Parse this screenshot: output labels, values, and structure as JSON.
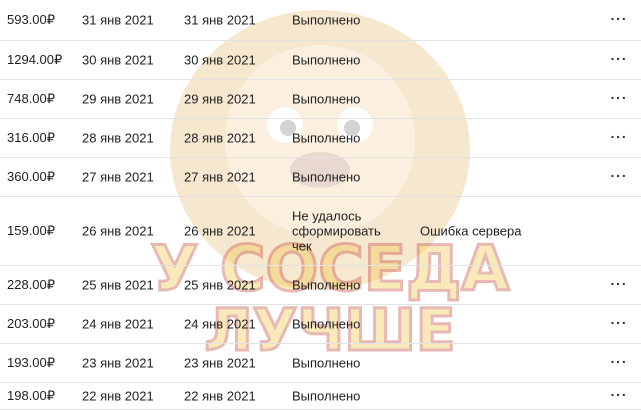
{
  "menu_glyph": "···",
  "rows": [
    {
      "amount": "593.00₽",
      "date_created": "31 янв 2021",
      "date_done": "31 янв 2021",
      "status": "Выполнено",
      "error": "",
      "has_menu": true
    },
    {
      "amount": "1294.00₽",
      "date_created": "30 янв 2021",
      "date_done": "30 янв 2021",
      "status": "Выполнено",
      "error": "",
      "has_menu": true
    },
    {
      "amount": "748.00₽",
      "date_created": "29 янв 2021",
      "date_done": "29 янв 2021",
      "status": "Выполнено",
      "error": "",
      "has_menu": true
    },
    {
      "amount": "316.00₽",
      "date_created": "28 янв 2021",
      "date_done": "28 янв 2021",
      "status": "Выполнено",
      "error": "",
      "has_menu": true
    },
    {
      "amount": "360.00₽",
      "date_created": "27 янв 2021",
      "date_done": "27 янв 2021",
      "status": "Выполнено",
      "error": "",
      "has_menu": true
    },
    {
      "amount": "159.00₽",
      "date_created": "26 янв 2021",
      "date_done": "26 янв 2021",
      "status": "Не удалось сформировать чек",
      "error": "Ошибка сервера",
      "has_menu": false
    },
    {
      "amount": "228.00₽",
      "date_created": "25 янв 2021",
      "date_done": "25 янв 2021",
      "status": "Выполнено",
      "error": "",
      "has_menu": true
    },
    {
      "amount": "203.00₽",
      "date_created": "24 янв 2021",
      "date_done": "24 янв 2021",
      "status": "Выполнено",
      "error": "",
      "has_menu": true
    },
    {
      "amount": "193.00₽",
      "date_created": "23 янв 2021",
      "date_done": "23 янв 2021",
      "status": "Выполнено",
      "error": "",
      "has_menu": true
    },
    {
      "amount": "198.00₽",
      "date_created": "22 янв 2021",
      "date_done": "22 янв 2021",
      "status": "Выполнено",
      "error": "",
      "has_menu": true
    }
  ],
  "watermark": {
    "line1": "У СОСЕДА",
    "line2": "ЛУЧШЕ",
    "color": "#f2c23a",
    "outline": "#c0392b"
  }
}
